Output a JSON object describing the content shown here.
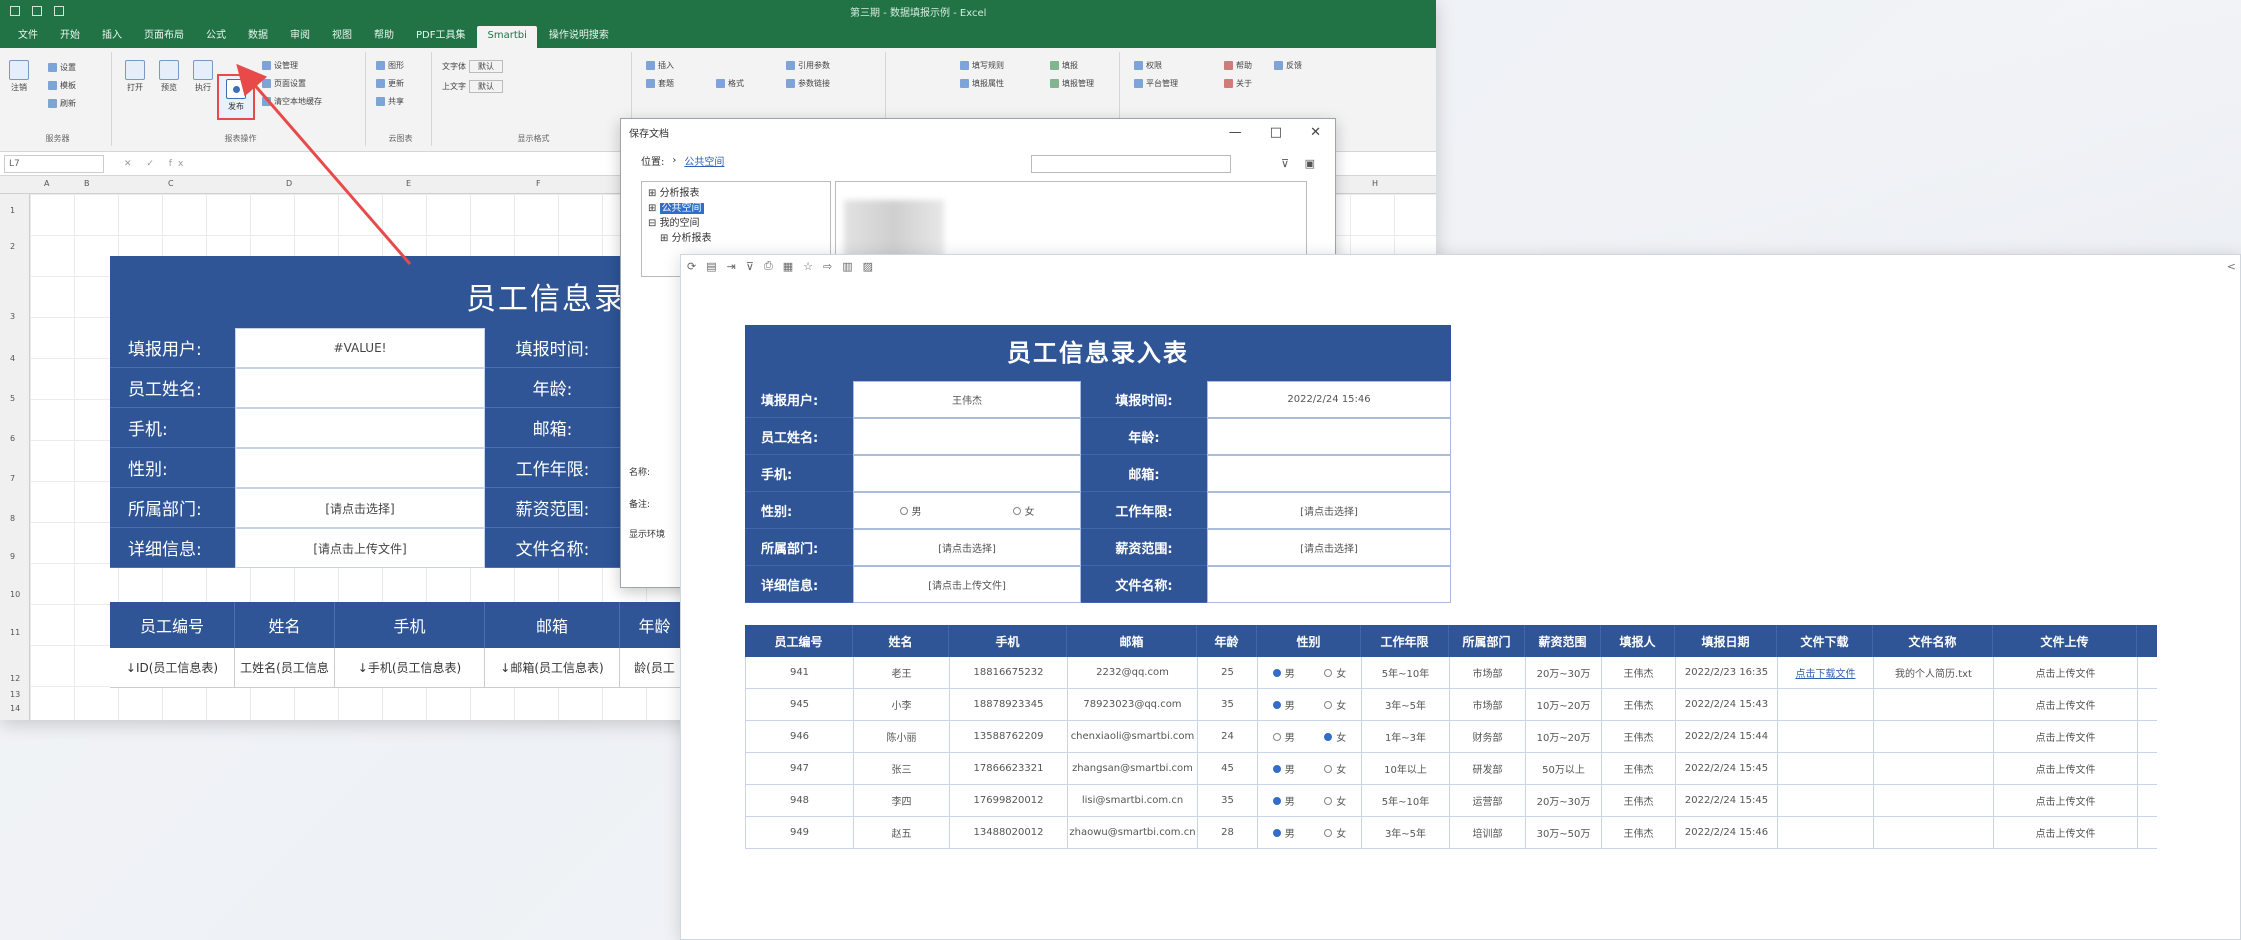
{
  "excel": {
    "window_title": "第三期 - 数据填报示例 - Excel",
    "menu": [
      "文件",
      "开始",
      "插入",
      "页面布局",
      "公式",
      "数据",
      "审阅",
      "视图",
      "帮助",
      "PDF工具集",
      "Smartbi",
      "操作说明搜索"
    ],
    "active_menu": "Smartbi",
    "ribbon": {
      "server_group": "服务器",
      "report_ops_group": "报表操作",
      "cloud_group": "云图表",
      "display_group": "显示格式",
      "settings": "设置",
      "template": "模板",
      "refresh": "刷新",
      "logout": "注销",
      "open": "打开",
      "preview": "预览",
      "execute": "执行",
      "publish": "发布",
      "manage": "设管理",
      "page_settings": "页面设置",
      "clear_cache": "清空本地缓存",
      "chart": "图形",
      "update": "更新",
      "share": "共享",
      "text_font": "文字体",
      "upper_font": "上文字",
      "default1": "默认",
      "default2": "默认",
      "insert": "插入",
      "header": "套题",
      "cond_format": "格式",
      "ref_param": "引用参数",
      "param_link": "参数链接",
      "write_rule": "填写规则",
      "spread": "填报属性",
      "wr_prop": "填报",
      "wr_manage": "填报管理",
      "permission": "权限",
      "platform_mgmt": "平台管理",
      "help": "帮助",
      "about": "关于",
      "feedback": "反馈"
    },
    "name_box": "L7",
    "col_headers": [
      "A",
      "B",
      "C",
      "D",
      "E",
      "F",
      "G",
      "H"
    ],
    "row_headers": [
      "1",
      "2",
      "3",
      "4",
      "5",
      "6",
      "7",
      "8",
      "9",
      "10",
      "11",
      "12",
      "13",
      "14"
    ],
    "form": {
      "title": "员工信息录入表",
      "rows": [
        {
          "label": "填报用户:",
          "value": "#VALUE!",
          "label2": "填报时间:"
        },
        {
          "label": "员工姓名:",
          "value": "",
          "label2": "年龄:"
        },
        {
          "label": "手机:",
          "value": "",
          "label2": "邮箱:"
        },
        {
          "label": "性别:",
          "value": "",
          "label2": "工作年限:"
        },
        {
          "label": "所属部门:",
          "value": "[请点击选择]",
          "label2": "薪资范围:"
        },
        {
          "label": "详细信息:",
          "value": "[请点击上传文件]",
          "label2": "文件名称:"
        }
      ]
    },
    "table": {
      "headers": [
        "员工编号",
        "姓名",
        "手机",
        "邮箱",
        "年龄"
      ],
      "row": [
        "↓ID(员工信息表)",
        "工姓名(员工信息",
        "↓手机(员工信息表)",
        "↓邮箱(员工信息表)",
        "龄(员工"
      ]
    }
  },
  "dialog": {
    "title": "保存文档",
    "location_label": "位置:",
    "location_path": "公共空间",
    "tree": [
      "分析报表",
      "公共空间",
      "我的空间",
      "分析报表"
    ],
    "selected_tree": "公共空间",
    "name_label": "名称:",
    "remark_label": "备注:",
    "env_label": "显示环境",
    "controls": [
      "—",
      "□",
      "✕"
    ]
  },
  "web": {
    "form": {
      "title": "员工信息录入表",
      "rows": [
        {
          "label": "填报用户:",
          "value": "王伟杰",
          "label2": "填报时间:",
          "value2": "2022/2/24 15:46"
        },
        {
          "label": "员工姓名:",
          "value": "",
          "label2": "年龄:",
          "value2": ""
        },
        {
          "label": "手机:",
          "value": "",
          "label2": "邮箱:",
          "value2": ""
        },
        {
          "label": "性别:",
          "value": "",
          "label2": "工作年限:",
          "value2": "[请点击选择]"
        },
        {
          "label": "所属部门:",
          "value": "[请点击选择]",
          "label2": "薪资范围:",
          "value2": "[请点击选择]"
        },
        {
          "label": "详细信息:",
          "value": "[请点击上传文件]",
          "label2": "文件名称:",
          "value2": ""
        }
      ],
      "gender_male": "男",
      "gender_female": "女"
    },
    "table": {
      "headers": [
        "员工编号",
        "姓名",
        "手机",
        "邮箱",
        "年龄",
        "性别",
        "工作年限",
        "所属部门",
        "薪资范围",
        "填报人",
        "填报日期",
        "文件下载",
        "文件名称",
        "文件上传"
      ],
      "rows": [
        {
          "id": "941",
          "name": "老王",
          "phone": "18816675232",
          "email": "2232@qq.com",
          "age": "25",
          "gender": "男",
          "years": "5年~10年",
          "dept": "市场部",
          "salary": "20万~30万",
          "filler": "王伟杰",
          "date": "2022/2/23 16:35",
          "download": "点击下载文件",
          "fname": "我的个人简历.txt",
          "upload": "点击上传文件"
        },
        {
          "id": "945",
          "name": "小李",
          "phone": "18878923345",
          "email": "78923023@qq.com",
          "age": "35",
          "gender": "男",
          "years": "3年~5年",
          "dept": "市场部",
          "salary": "10万~20万",
          "filler": "王伟杰",
          "date": "2022/2/24 15:43",
          "download": "",
          "fname": "",
          "upload": "点击上传文件"
        },
        {
          "id": "946",
          "name": "陈小丽",
          "phone": "13588762209",
          "email": "chenxiaoli@smartbi.com",
          "age": "24",
          "gender": "女",
          "years": "1年~3年",
          "dept": "财务部",
          "salary": "10万~20万",
          "filler": "王伟杰",
          "date": "2022/2/24 15:44",
          "download": "",
          "fname": "",
          "upload": "点击上传文件"
        },
        {
          "id": "947",
          "name": "张三",
          "phone": "17866623321",
          "email": "zhangsan@smartbi.com",
          "age": "45",
          "gender": "男",
          "years": "10年以上",
          "dept": "研发部",
          "salary": "50万以上",
          "filler": "王伟杰",
          "date": "2022/2/24 15:45",
          "download": "",
          "fname": "",
          "upload": "点击上传文件"
        },
        {
          "id": "948",
          "name": "李四",
          "phone": "17699820012",
          "email": "lisi@smartbi.com.cn",
          "age": "35",
          "gender": "男",
          "years": "5年~10年",
          "dept": "运营部",
          "salary": "20万~30万",
          "filler": "王伟杰",
          "date": "2022/2/24 15:45",
          "download": "",
          "fname": "",
          "upload": "点击上传文件"
        },
        {
          "id": "949",
          "name": "赵五",
          "phone": "13488020012",
          "email": "zhaowu@smartbi.com.cn",
          "age": "28",
          "gender": "男",
          "years": "3年~5年",
          "dept": "培训部",
          "salary": "30万~50万",
          "filler": "王伟杰",
          "date": "2022/2/24 15:46",
          "download": "",
          "fname": "",
          "upload": "点击上传文件"
        }
      ]
    },
    "share_icon": "share-icon"
  },
  "colors": {
    "form_blue": "#2f5597",
    "excel_green": "#217346",
    "highlight_red": "#e84a4a",
    "link_blue": "#2f5fb3"
  }
}
